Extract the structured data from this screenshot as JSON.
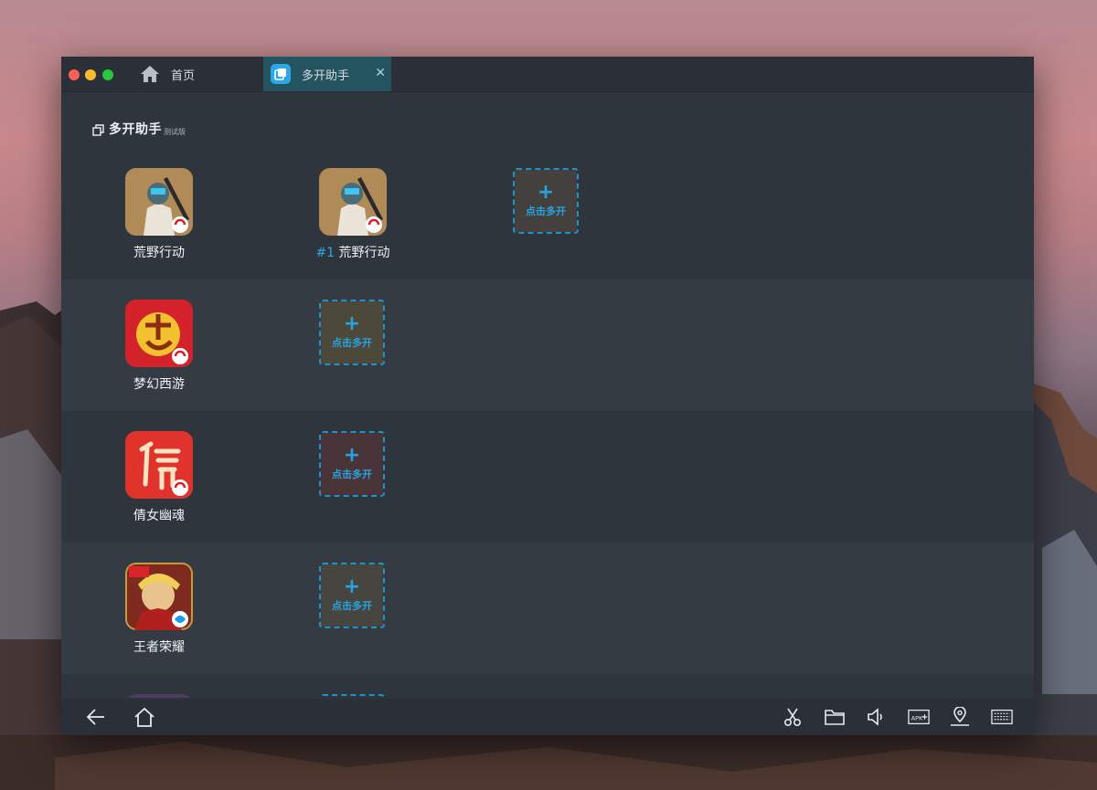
{
  "tabs": [
    {
      "label": "首页",
      "icon": "home-icon"
    },
    {
      "label": "多开助手",
      "icon": "multi-open-app-icon",
      "close": "✕"
    }
  ],
  "header": {
    "title": "多开助手",
    "badge": "测试版",
    "icon": "copy-windows-icon"
  },
  "add_label": "点击多开",
  "add_plus": "+",
  "rows": [
    {
      "app": "荒野行动",
      "clones": [
        {
          "num": "#1",
          "name": "荒野行动"
        }
      ]
    },
    {
      "app": "梦幻西游",
      "clones": []
    },
    {
      "app": "倩女幽魂",
      "clones": []
    },
    {
      "app": "王者荣耀",
      "clones": []
    }
  ],
  "bottombar": {
    "left": [
      "back-arrow-icon",
      "home-icon"
    ],
    "right": [
      "scissors-icon",
      "folder-icon",
      "volume-icon",
      "apk-install-icon",
      "location-pin-icon",
      "keyboard-icon"
    ]
  },
  "colors": {
    "accent": "#2ea7e6",
    "window_bg": "#2f353d",
    "row_alt": "#353b43",
    "active_tab": "#24545f"
  }
}
